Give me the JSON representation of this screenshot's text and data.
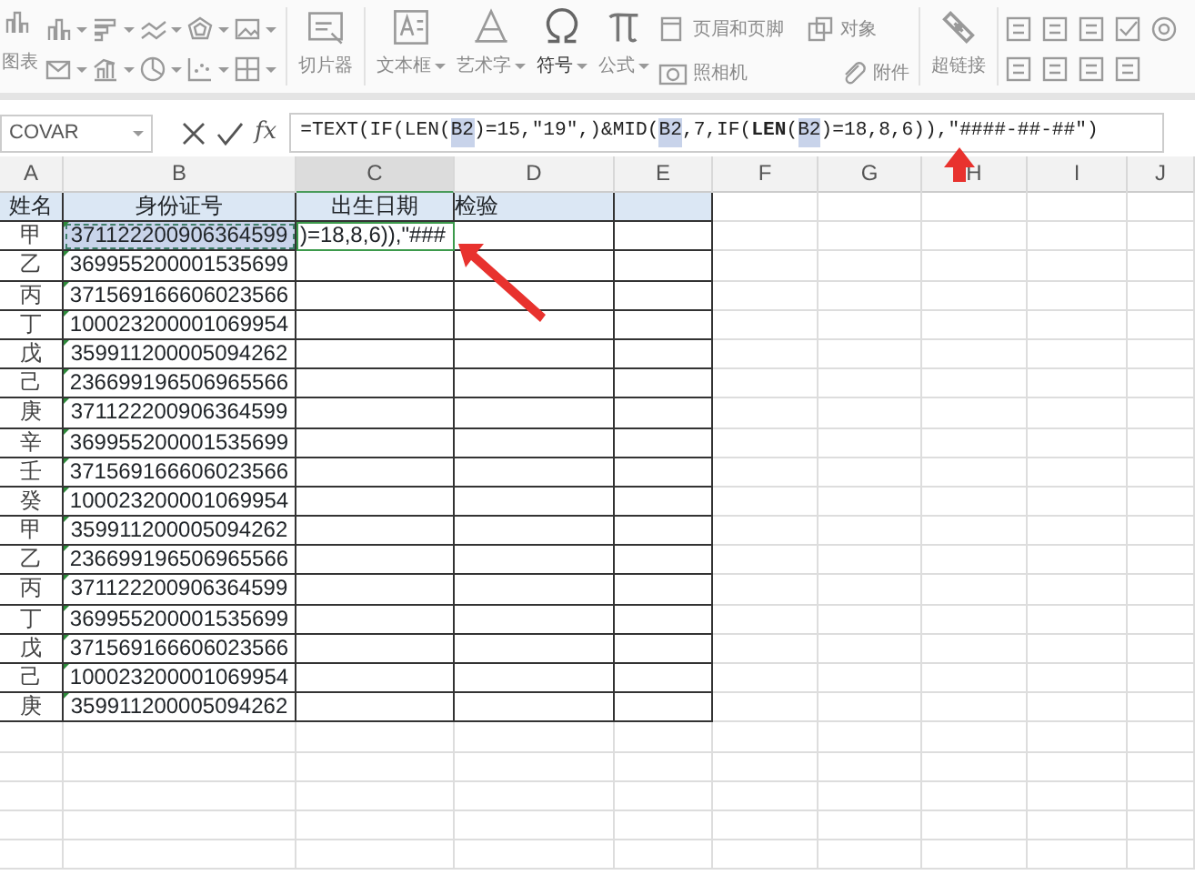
{
  "ribbon": {
    "chart_label": "图表",
    "big_buttons": [
      {
        "label": "切片器",
        "dropdown": false
      },
      {
        "label": "文本框",
        "dropdown": true
      },
      {
        "label": "艺术字",
        "dropdown": true
      },
      {
        "label": "符号",
        "dropdown": true
      },
      {
        "label": "公式",
        "dropdown": true
      }
    ],
    "small_buttons": [
      {
        "label": "页眉和页脚"
      },
      {
        "label": "照相机"
      },
      {
        "label": "对象"
      },
      {
        "label": "附件"
      }
    ],
    "link_button": {
      "label": "超链接"
    }
  },
  "name_box": "COVAR",
  "function_label": "fx",
  "formula": [
    {
      "kind": "plain",
      "text": "=TEXT(IF(LEN("
    },
    {
      "kind": "ref",
      "text": "B2"
    },
    {
      "kind": "plain",
      "text": ")=15,\"19\",)&MID("
    },
    {
      "kind": "ref",
      "text": "B2"
    },
    {
      "kind": "plain",
      "text": ",7,IF("
    },
    {
      "kind": "bold",
      "text": "LEN"
    },
    {
      "kind": "plain",
      "text": "("
    },
    {
      "kind": "ref",
      "text": "B2"
    },
    {
      "kind": "plain",
      "text": ")=18,8,6)),\"####-##-##\")"
    }
  ],
  "columns": [
    {
      "label": "A",
      "selected": false
    },
    {
      "label": "B",
      "selected": false
    },
    {
      "label": "C",
      "selected": true
    },
    {
      "label": "D",
      "selected": false
    },
    {
      "label": "E",
      "selected": false
    },
    {
      "label": "F",
      "selected": false
    },
    {
      "label": "G",
      "selected": false
    },
    {
      "label": "H",
      "selected": false
    },
    {
      "label": "I",
      "selected": false
    },
    {
      "label": "J",
      "selected": false
    }
  ],
  "header_row": [
    "姓名",
    "身份证号",
    "出生日期",
    "检验"
  ],
  "rows": [
    {
      "name": "甲",
      "id": "371122200906364599",
      "copied": true,
      "editing_text": ")=18,8,6)),\"###"
    },
    {
      "name": "乙",
      "id": "369955200001535699",
      "copied": false
    },
    {
      "name": "丙",
      "id": "371569166606023566",
      "copied": false
    },
    {
      "name": "丁",
      "id": "100023200001069954",
      "copied": false
    },
    {
      "name": "戊",
      "id": "359911200005094262",
      "copied": false
    },
    {
      "name": "己",
      "id": "236699196506965566",
      "copied": false
    },
    {
      "name": "庚",
      "id": "371122200906364599",
      "copied": false
    },
    {
      "name": "辛",
      "id": "369955200001535699",
      "copied": false
    },
    {
      "name": "壬",
      "id": "371569166606023566",
      "copied": false
    },
    {
      "name": "癸",
      "id": "100023200001069954",
      "copied": false
    },
    {
      "name": "甲",
      "id": "359911200005094262",
      "copied": false
    },
    {
      "name": "乙",
      "id": "236699196506965566",
      "copied": false
    },
    {
      "name": "丙",
      "id": "371122200906364599",
      "copied": false
    },
    {
      "name": "丁",
      "id": "369955200001535699",
      "copied": false
    },
    {
      "name": "戊",
      "id": "371569166606023566",
      "copied": false
    },
    {
      "name": "己",
      "id": "100023200001069954",
      "copied": false
    },
    {
      "name": "庚",
      "id": "359911200005094262",
      "copied": false
    }
  ]
}
